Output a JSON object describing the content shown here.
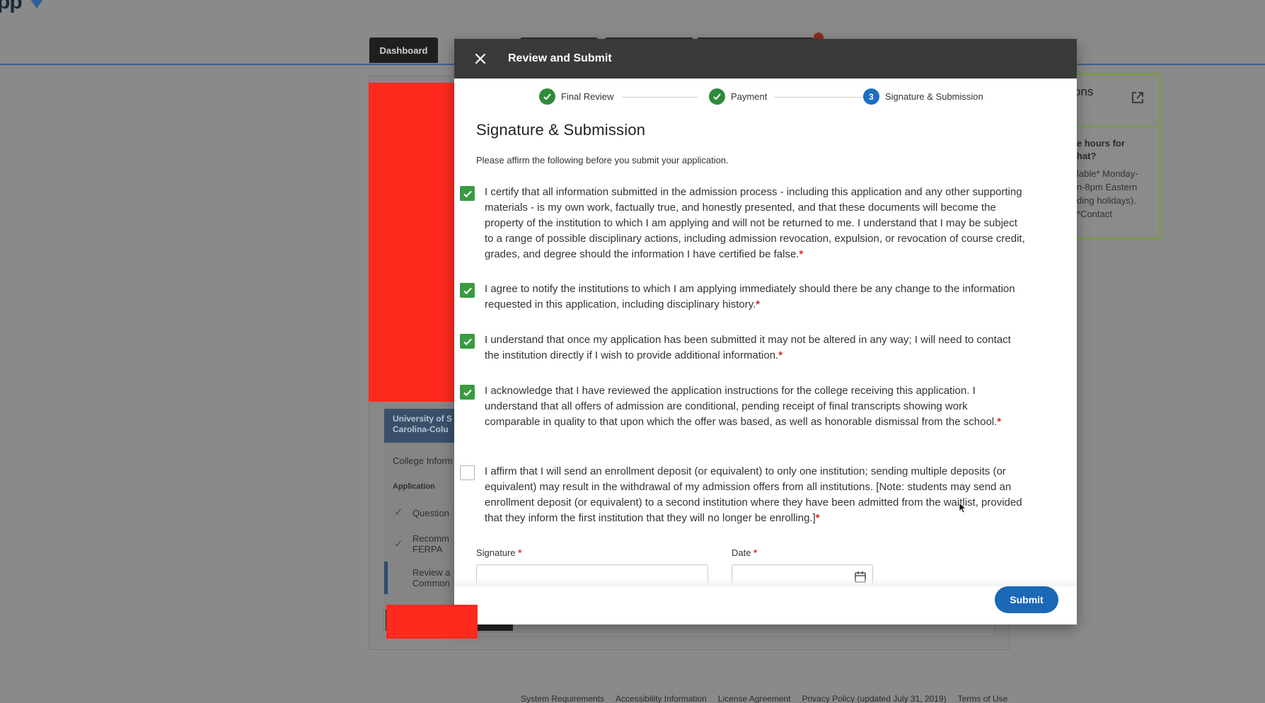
{
  "background": {
    "logo_text": "pp",
    "tabs": {
      "dashboard": "Dashboard"
    },
    "sidebar": {
      "university": "University of S\nCarolina-Colu",
      "college_info": "College Inform",
      "application_heading": "Application",
      "items": [
        {
          "label": "Question",
          "checked": true
        },
        {
          "label": "Recomm\nFERPA",
          "checked": true
        },
        {
          "label": "Review a\nCommon",
          "checked": false
        }
      ]
    },
    "help": {
      "title": "ons",
      "question": "e hours for\nhat?",
      "answer": "lable* Monday-\nn-8pm Eastern\nding holidays).\n*Contact"
    },
    "footer_links": [
      "System Requirements",
      "Accessibility Information",
      "License Agreement",
      "Privacy Policy (updated July 31, 2019)",
      "Terms of Use"
    ]
  },
  "modal": {
    "title": "Review and Submit",
    "steps": [
      {
        "label": "Final Review",
        "status": "done"
      },
      {
        "label": "Payment",
        "status": "done"
      },
      {
        "label": "Signature & Submission",
        "status": "current",
        "number": "3"
      }
    ],
    "section_title": "Signature & Submission",
    "intro": "Please affirm the following before you submit your application.",
    "affirmations": [
      {
        "text": "I certify that all information submitted in the admission process - including this application and any other supporting materials - is my own work, factually true, and honestly presented, and that these documents will become the property of the institution to which I am applying and will not be returned to me. I understand that I may be subject to a range of possible disciplinary actions, including admission revocation, expulsion, or revocation of course credit, grades, and degree should the information I have certified be false.",
        "checked": true
      },
      {
        "text": "I agree to notify the institutions to which I am applying immediately should there be any change to the information requested in this application, including disciplinary history.",
        "checked": true
      },
      {
        "text": "I understand that once my application has been submitted it may not be altered in any way; I will need to contact the institution directly if I wish to provide additional information.",
        "checked": true
      },
      {
        "text": "I acknowledge that I have reviewed the application instructions for the college receiving this application. I understand that all offers of admission are conditional, pending receipt of final transcripts showing work comparable in quality to that upon which the offer was based, as well as honorable dismissal from the school.",
        "checked": true
      },
      {
        "text": "I affirm that I will send an enrollment deposit (or equivalent) to only one institution; sending multiple deposits (or equivalent) may result in the withdrawal of my admission offers from all institutions. [Note: students may send an enrollment deposit (or equivalent) to a second institution where they have been admitted from the waitlist, provided that they inform the first institution that they will no longer be enrolling.]",
        "checked": false
      }
    ],
    "required_mark": "*",
    "signature_label": "Signature",
    "date_label": "Date",
    "signature_value": "",
    "date_value": "",
    "submit_label": "Submit"
  },
  "colors": {
    "check_green": "#3a9a40",
    "step_blue": "#1b6fc2",
    "submit_blue": "#1b68b6",
    "required_red": "#d9262a",
    "redaction_red": "#fe2a1e",
    "header_dark": "#3a3a3a"
  }
}
